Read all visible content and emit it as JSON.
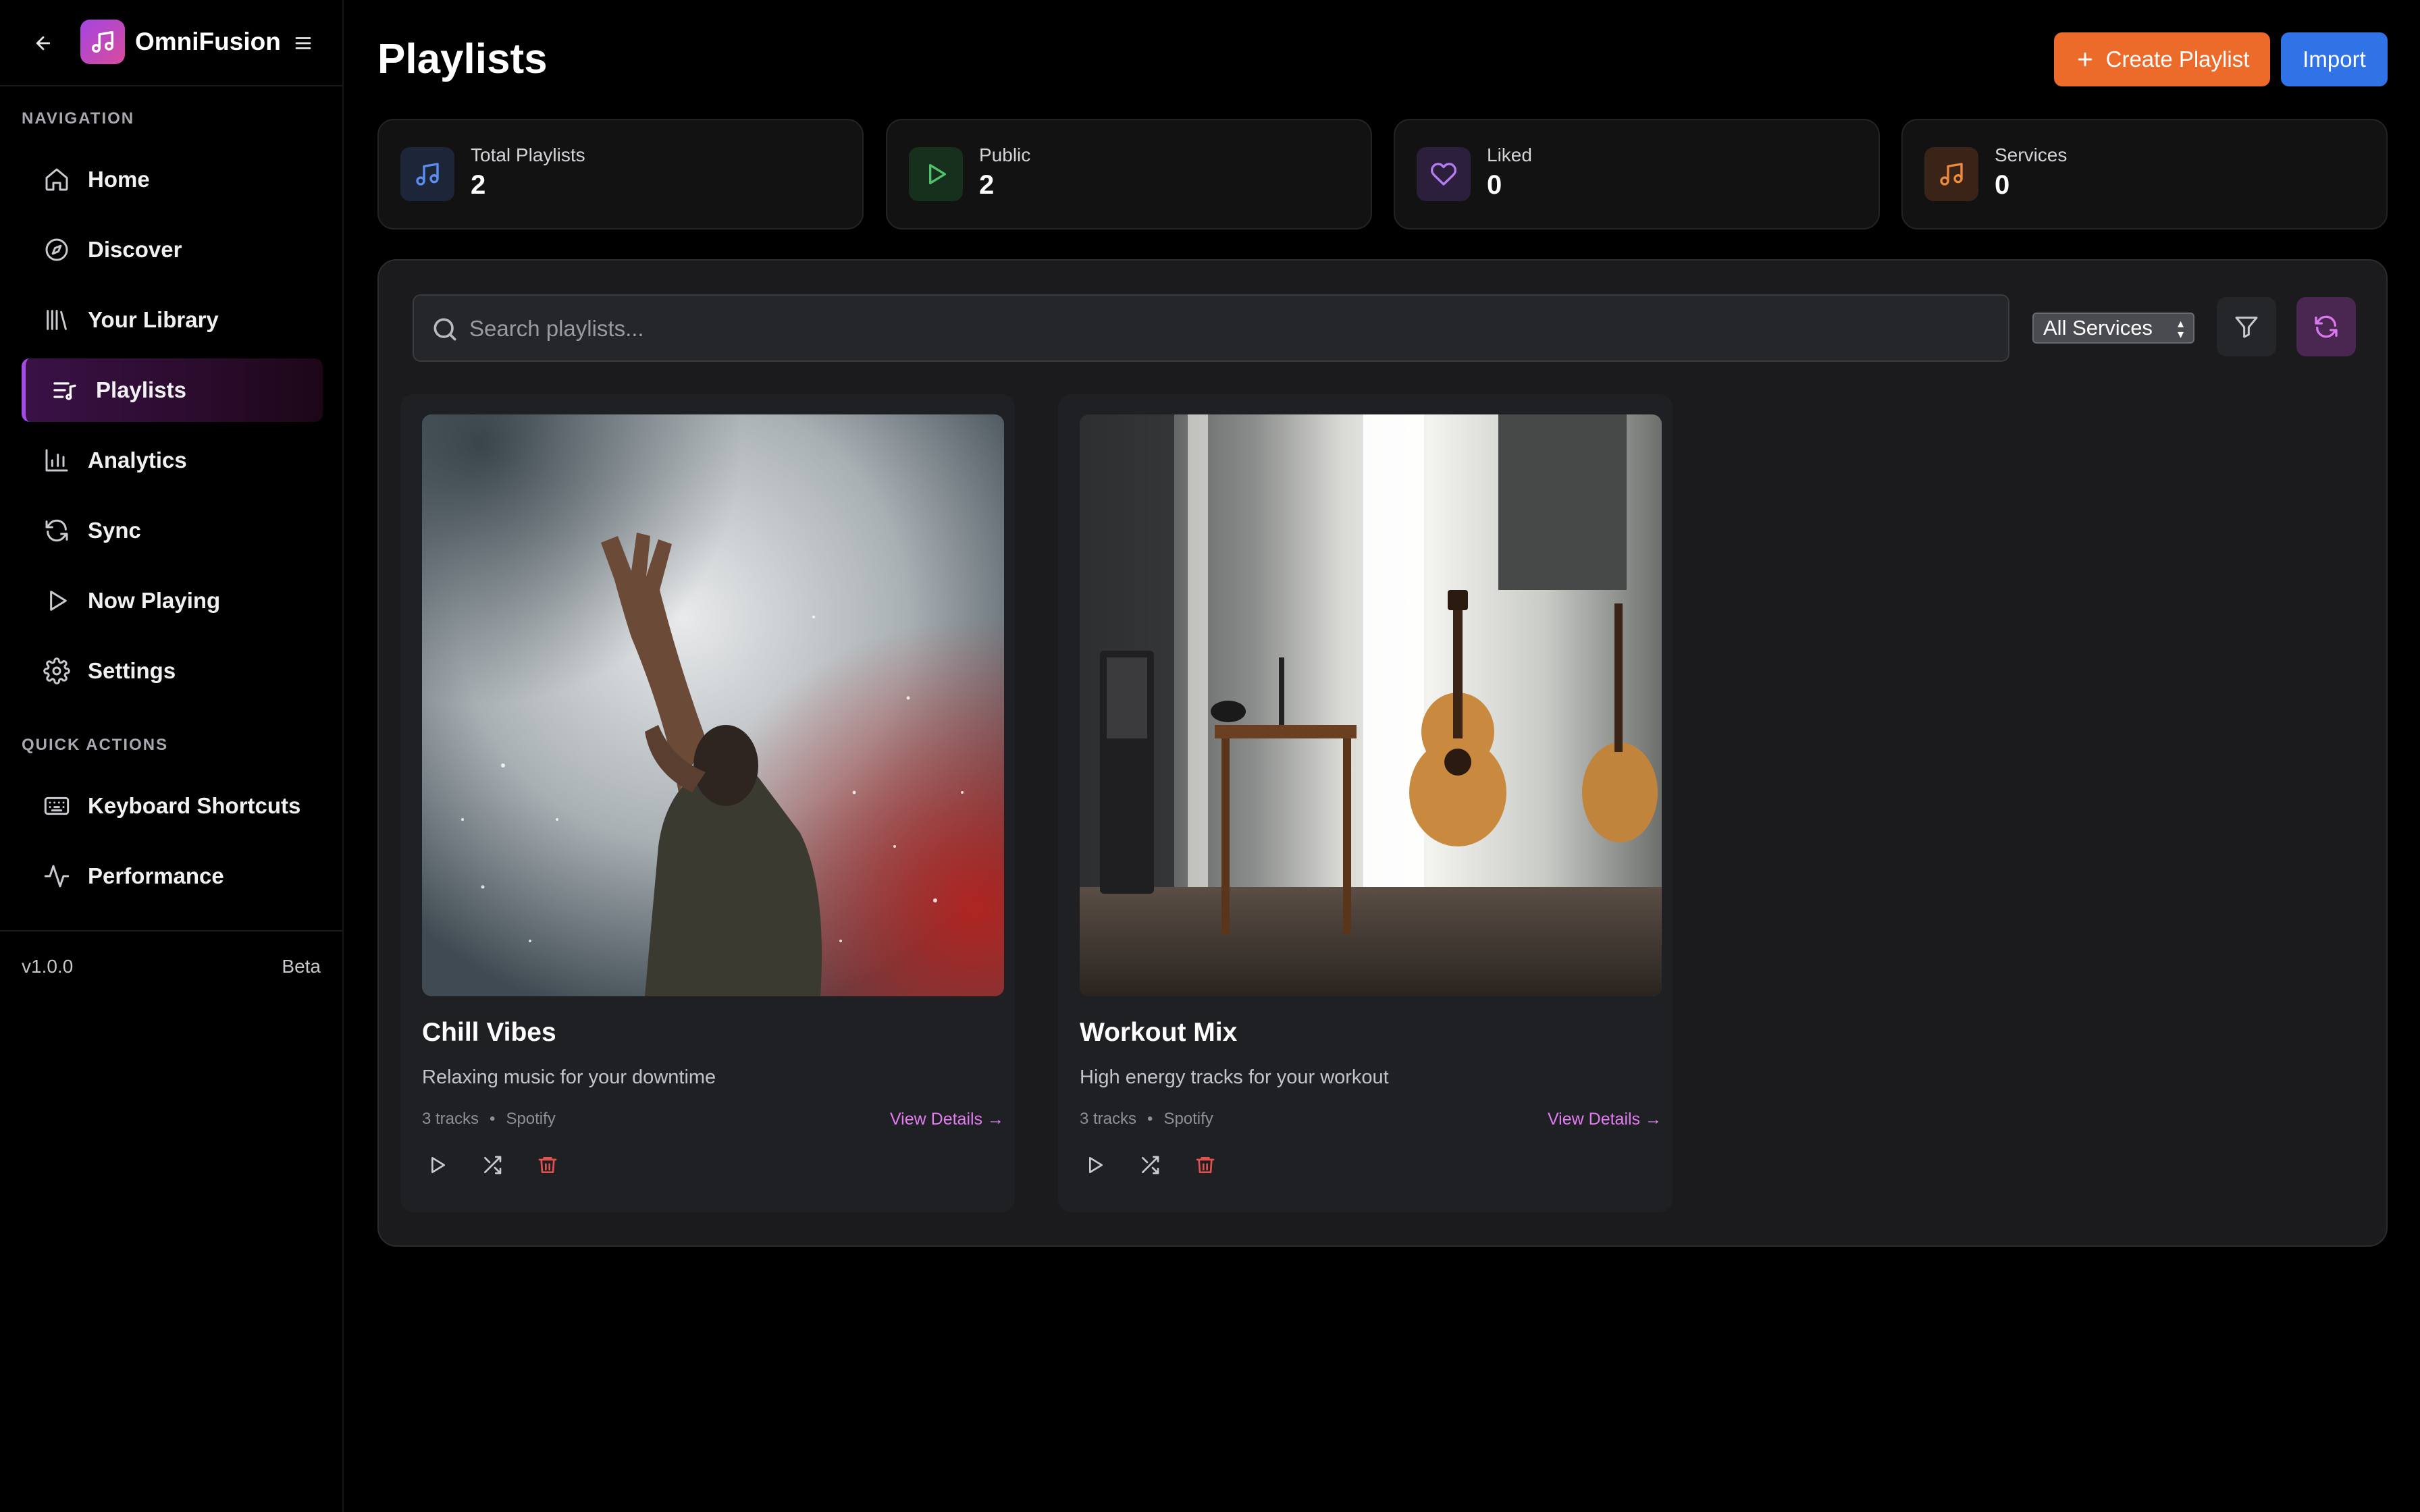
{
  "app": {
    "name": "OmniFusion"
  },
  "sidebar": {
    "nav_title": "NAVIGATION",
    "items": [
      {
        "label": "Home",
        "icon": "home-icon"
      },
      {
        "label": "Discover",
        "icon": "compass-icon"
      },
      {
        "label": "Your Library",
        "icon": "library-icon"
      },
      {
        "label": "Playlists",
        "icon": "playlist-icon",
        "active": true
      },
      {
        "label": "Analytics",
        "icon": "bar-chart-icon"
      },
      {
        "label": "Sync",
        "icon": "refresh-icon"
      },
      {
        "label": "Now Playing",
        "icon": "play-icon"
      },
      {
        "label": "Settings",
        "icon": "gear-icon"
      }
    ],
    "quick_title": "QUICK ACTIONS",
    "quick_items": [
      {
        "label": "Keyboard Shortcuts",
        "icon": "keyboard-icon"
      },
      {
        "label": "Performance",
        "icon": "activity-icon"
      }
    ],
    "version": "v1.0.0",
    "badge": "Beta"
  },
  "header": {
    "title": "Playlists",
    "create_label": "Create Playlist",
    "import_label": "Import"
  },
  "stats": [
    {
      "label": "Total Playlists",
      "value": "2",
      "icon": "music-note-icon",
      "color": "#5b8ef0"
    },
    {
      "label": "Public",
      "value": "2",
      "icon": "play-icon",
      "color": "#4ec36a"
    },
    {
      "label": "Liked",
      "value": "0",
      "icon": "heart-icon",
      "color": "#b57cf2"
    },
    {
      "label": "Services",
      "value": "0",
      "icon": "music-note-icon",
      "color": "#ee8a3c"
    }
  ],
  "toolbar": {
    "search_placeholder": "Search playlists...",
    "service_filter": "All Services"
  },
  "playlists": [
    {
      "name": "Chill Vibes",
      "description": "Relaxing music for your downtime",
      "tracks": "3 tracks",
      "service": "Spotify",
      "view_label": "View Details →"
    },
    {
      "name": "Workout Mix",
      "description": "High energy tracks for your workout",
      "tracks": "3 tracks",
      "service": "Spotify",
      "view_label": "View Details →"
    }
  ],
  "colors": {
    "accent": "#a44de6",
    "create": "#ec6b2a",
    "import": "#2f73e6",
    "link": "#e37cf1",
    "danger": "#e0524f"
  }
}
